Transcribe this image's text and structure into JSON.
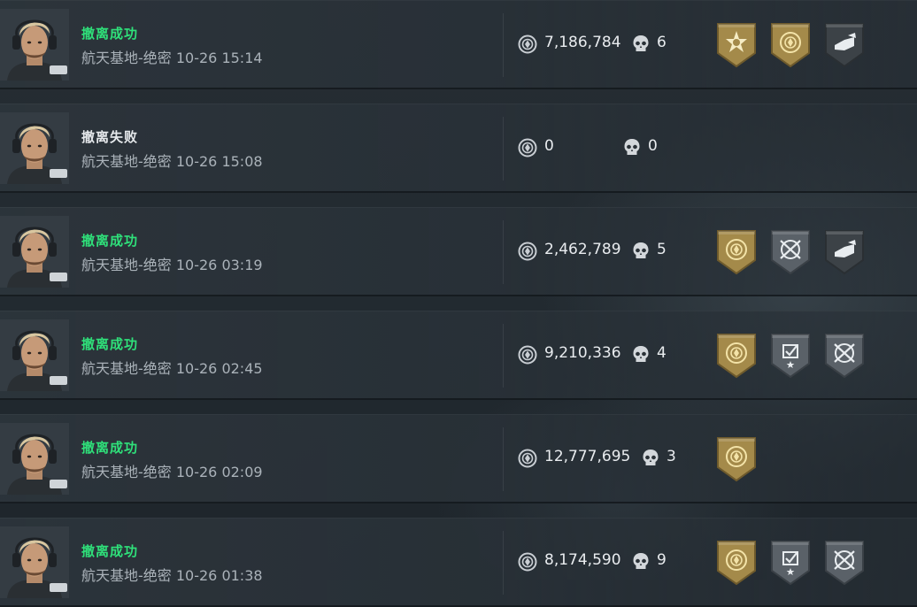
{
  "records": [
    {
      "status": "撤离成功",
      "result": "success",
      "map_time": "航天基地-绝密 10-26 15:14",
      "value": "7,186,784",
      "kills": "6",
      "badges": [
        "gold-star-badge",
        "gold-coin-badge",
        "gray-hand-badge"
      ]
    },
    {
      "status": "撤离失败",
      "result": "fail",
      "map_time": "航天基地-绝密 10-26 15:08",
      "value": "0",
      "kills": "0",
      "badges": []
    },
    {
      "status": "撤离成功",
      "result": "success",
      "map_time": "航天基地-绝密 10-26 03:19",
      "value": "2,462,789",
      "kills": "5",
      "badges": [
        "gold-coin-badge",
        "gray-crosshair-badge",
        "gray-hand-badge"
      ]
    },
    {
      "status": "撤离成功",
      "result": "success",
      "map_time": "航天基地-绝密 10-26 02:45",
      "value": "9,210,336",
      "kills": "4",
      "badges": [
        "gold-coin-badge",
        "gray-check-badge",
        "gray-crosshair-badge"
      ]
    },
    {
      "status": "撤离成功",
      "result": "success",
      "map_time": "航天基地-绝密 10-26 02:09",
      "value": "12,777,695",
      "kills": "3",
      "badges": [
        "gold-coin-badge"
      ]
    },
    {
      "status": "撤离成功",
      "result": "success",
      "map_time": "航天基地-绝密 10-26 01:38",
      "value": "8,174,590",
      "kills": "9",
      "badges": [
        "gold-coin-badge",
        "gray-check-badge",
        "gray-crosshair-badge"
      ]
    }
  ],
  "colors": {
    "success": "#2fe07a",
    "fail": "#e6e9ec",
    "gold_badge": "#a48a4a",
    "gray_badge": "#5a6168"
  }
}
